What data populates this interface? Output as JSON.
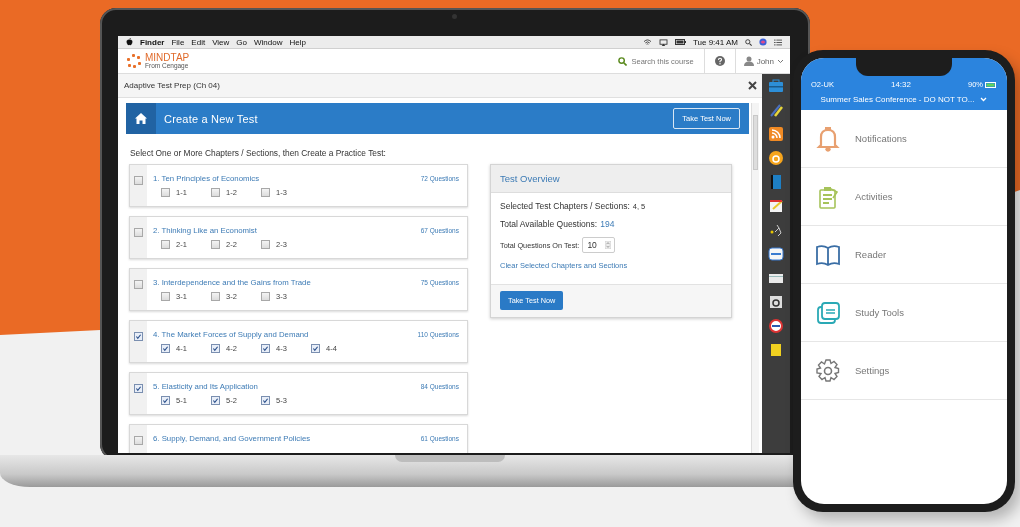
{
  "menu_bar": {
    "items": [
      "Finder",
      "File",
      "Edit",
      "View",
      "Go",
      "Window",
      "Help"
    ],
    "clock": "Tue 9:41 AM"
  },
  "header": {
    "logo": "MINDTAP",
    "logo_sub": "From Cengage",
    "search_placeholder": "Search this course",
    "user": "John"
  },
  "page_title": "Adaptive Test Prep (Ch 04)",
  "banner": {
    "title": "Create a New Test",
    "button": "Take Test Now"
  },
  "instruction": "Select One or More Chapters / Sections, then Create a Practice Test:",
  "chapters": [
    {
      "title": "1. Ten Principles of Economics",
      "count": "72 Questions",
      "checked": false,
      "sections": [
        {
          "label": "1-1",
          "checked": false
        },
        {
          "label": "1-2",
          "checked": false
        },
        {
          "label": "1-3",
          "checked": false
        }
      ]
    },
    {
      "title": "2. Thinking Like an Economist",
      "count": "67 Questions",
      "checked": false,
      "sections": [
        {
          "label": "2-1",
          "checked": false
        },
        {
          "label": "2-2",
          "checked": false
        },
        {
          "label": "2-3",
          "checked": false
        }
      ]
    },
    {
      "title": "3. Interdependence and the Gains from Trade",
      "count": "75 Questions",
      "checked": false,
      "sections": [
        {
          "label": "3-1",
          "checked": false
        },
        {
          "label": "3-2",
          "checked": false
        },
        {
          "label": "3-3",
          "checked": false
        }
      ]
    },
    {
      "title": "4. The Market Forces of Supply and Demand",
      "count": "110 Questions",
      "checked": true,
      "sections": [
        {
          "label": "4-1",
          "checked": true
        },
        {
          "label": "4-2",
          "checked": true
        },
        {
          "label": "4-3",
          "checked": true
        },
        {
          "label": "4-4",
          "checked": true
        }
      ]
    },
    {
      "title": "5. Elasticity and Its Application",
      "count": "84 Questions",
      "checked": true,
      "sections": [
        {
          "label": "5-1",
          "checked": true
        },
        {
          "label": "5-2",
          "checked": true
        },
        {
          "label": "5-3",
          "checked": true
        }
      ]
    },
    {
      "title": "6. Supply, Demand, and Government Policies",
      "count": "61 Questions",
      "checked": false
    }
  ],
  "overview": {
    "title": "Test Overview",
    "selected_label": "Selected Test Chapters / Sections:",
    "selected_value": "4, 5",
    "available_label": "Total Available Questions:",
    "available_value": "194",
    "total_label": "Total Questions On Test:",
    "total_value": "10",
    "clear_link": "Clear Selected Chapters and Sections",
    "button": "Take Test Now"
  },
  "phone": {
    "carrier": "O2-UK",
    "time": "14:32",
    "battery": "90%",
    "title": "Summer Sales Conference - DO NOT TO...",
    "items": [
      {
        "label": "Notifications",
        "kind": "bell",
        "color": "#e8a070"
      },
      {
        "label": "Activities",
        "kind": "clipboard",
        "color": "#a6c35a"
      },
      {
        "label": "Reader",
        "kind": "book",
        "color": "#3a6ea5"
      },
      {
        "label": "Study Tools",
        "kind": "tools",
        "color": "#2aa9b5"
      },
      {
        "label": "Settings",
        "kind": "gear",
        "color": "#777777"
      }
    ]
  }
}
